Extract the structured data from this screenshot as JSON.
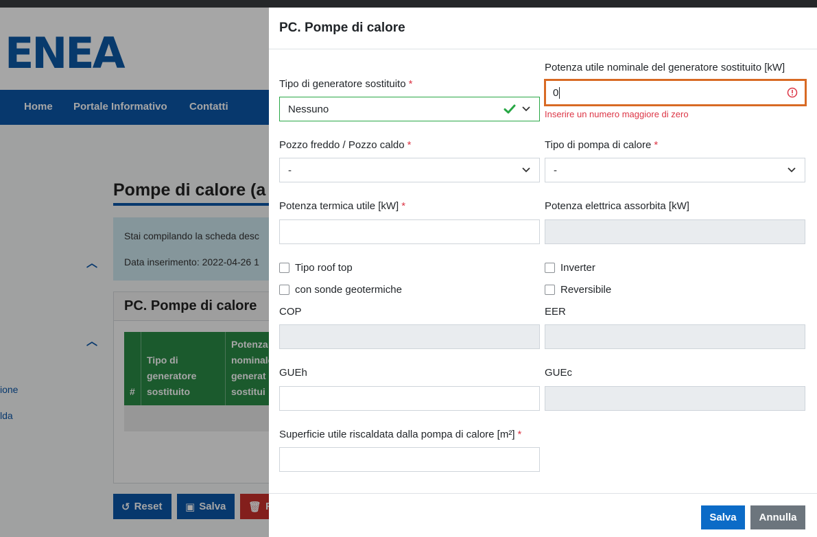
{
  "background": {
    "logo_text": "ENEA",
    "nav": [
      "Home",
      "Portale Informativo",
      "Contatti"
    ],
    "page_title": "Pompe di calore (a",
    "info_lines": [
      "Stai compilando la scheda desc",
      "Data inserimento: 2022-04-26 1"
    ],
    "card_title": "PC. Pompe di calore",
    "table_headers": [
      "#",
      "Tipo di generatore sostituito",
      "Potenza nominale generat sostitui"
    ],
    "side_links": [
      "ione",
      "lda"
    ],
    "buttons": {
      "reset": "Reset",
      "save": "Salva",
      "remove": "R"
    }
  },
  "modal": {
    "title": "PC. Pompe di calore",
    "fields": {
      "generatore_tipo": {
        "label": "Tipo di generatore sostituito",
        "value": "Nessuno"
      },
      "potenza_generatore": {
        "label": "Potenza utile nominale del generatore sostituito [kW]",
        "value": "0",
        "error": "Inserire un numero maggiore di zero"
      },
      "pozzo": {
        "label": "Pozzo freddo / Pozzo caldo",
        "value": "-"
      },
      "tipo_pompa": {
        "label": "Tipo di pompa di calore",
        "value": "-"
      },
      "potenza_termica": {
        "label": "Potenza termica utile [kW]",
        "value": ""
      },
      "potenza_elettrica": {
        "label": "Potenza elettrica assorbita [kW]",
        "value": ""
      },
      "cop": {
        "label": "COP",
        "value": ""
      },
      "eer": {
        "label": "EER",
        "value": ""
      },
      "gueh": {
        "label": "GUEh",
        "value": ""
      },
      "guec": {
        "label": "GUEc",
        "value": ""
      },
      "superficie": {
        "label": "Superficie utile riscaldata dalla pompa di calore [m²]",
        "value": ""
      }
    },
    "checkboxes": {
      "roof_top": {
        "label": "Tipo roof top",
        "checked": false
      },
      "sonde": {
        "label": "con sonde geotermiche",
        "checked": false
      },
      "inverter": {
        "label": "Inverter",
        "checked": false
      },
      "reversibile": {
        "label": "Reversibile",
        "checked": false
      }
    },
    "required_mark": "*",
    "footer": {
      "save": "Salva",
      "cancel": "Annulla"
    }
  },
  "colors": {
    "primary": "#0b6bc7",
    "nav": "#0b56a8",
    "table_header": "#2a8a45",
    "error": "#dc3545",
    "invalid_border": "#d86a24",
    "valid": "#28a745"
  }
}
